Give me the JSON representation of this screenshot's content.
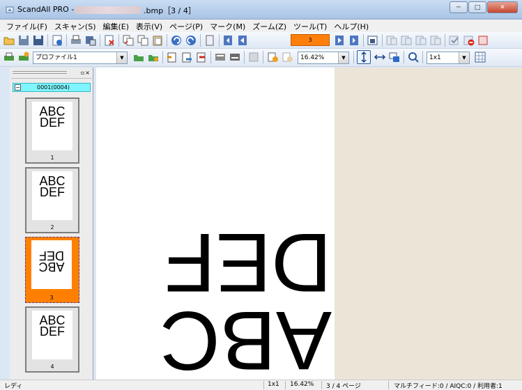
{
  "window": {
    "title_prefix": "ScandAll PRO -",
    "title_suffix": ".bmp［3 / 4］",
    "controls": {
      "minimize": "─",
      "maximize": "□",
      "close": "✕"
    }
  },
  "menubar": {
    "items": [
      "ファイル(F)",
      "スキャン(S)",
      "編集(E)",
      "表示(V)",
      "ページ(P)",
      "マーク(M)",
      "ズーム(Z)",
      "ツール(T)",
      "ヘルプ(H)"
    ]
  },
  "toolbar": {
    "page_number": "3",
    "profile_select": "プロファイル1",
    "zoom_select": "16.42%",
    "layout_select": "1x1"
  },
  "thumbnail_panel": {
    "group_label": "0001(0004)",
    "pages": [
      {
        "number": "1",
        "line1": "ABC",
        "line2": "DEF",
        "selected": false
      },
      {
        "number": "2",
        "line1": "ABC",
        "line2": "DEF",
        "selected": false
      },
      {
        "number": "3",
        "line1": "ABC",
        "line2": "DEF",
        "selected": true
      },
      {
        "number": "4",
        "line1": "ABC",
        "line2": "DEF",
        "selected": false
      }
    ]
  },
  "document_view": {
    "line1": "ABC",
    "line2": "DEF"
  },
  "statusbar": {
    "status": "レディ",
    "layout": "1x1",
    "zoom": "16.42%",
    "page": "3 / 4 ページ",
    "counters": "マルチフィード:0 / AIQC:0 / 利用者:1"
  },
  "colors": {
    "selected_thumb": "#ff8000",
    "group_bar": "#7ff6ff",
    "page_indicator": "#ff7f0a"
  }
}
